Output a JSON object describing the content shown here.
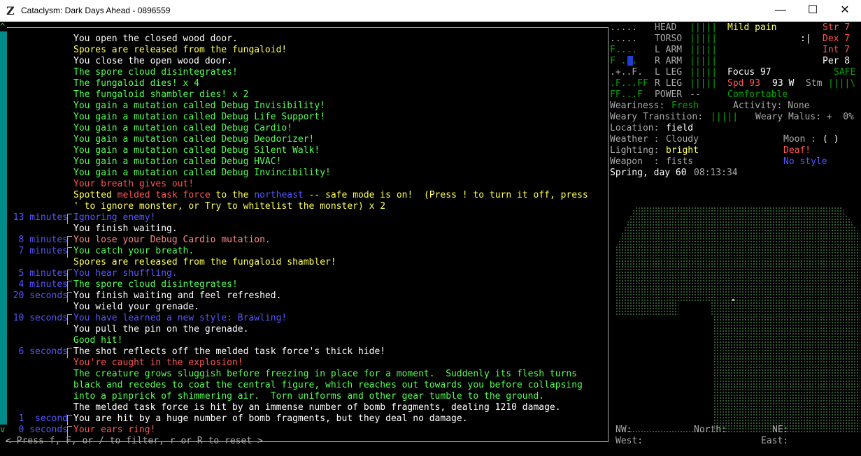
{
  "window": {
    "title": "Cataclysm: Dark Days Ahead - 0896559",
    "icon": "Z",
    "minimize_glyph": "—",
    "maximize_glyph": "☐",
    "close_glyph": "✕"
  },
  "colors": {
    "white": "#ffffff",
    "yellow": "#ffff55",
    "green": "#55ff55",
    "red": "#ff5555",
    "blue": "#5555ff",
    "lightred": "#ff8888",
    "gray": "#aaaaaa",
    "darkgreen": "#00aa00"
  },
  "scroll": {
    "up": "^",
    "down": "v"
  },
  "log": [
    {
      "time": "",
      "parts": [
        {
          "text": "You open the closed wood door.",
          "color": "white"
        }
      ]
    },
    {
      "time": "",
      "parts": [
        {
          "text": "Spores are released from the fungaloid!",
          "color": "yellow"
        }
      ]
    },
    {
      "time": "",
      "parts": [
        {
          "text": "You close the open wood door.",
          "color": "white"
        }
      ]
    },
    {
      "time": "",
      "parts": [
        {
          "text": "The spore cloud disintegrates!",
          "color": "green"
        }
      ]
    },
    {
      "time": "",
      "parts": [
        {
          "text": "The fungaloid dies! x 4",
          "color": "green"
        }
      ]
    },
    {
      "time": "",
      "parts": [
        {
          "text": "The fungaloid shambler dies! x 2",
          "color": "green"
        }
      ]
    },
    {
      "time": "",
      "parts": [
        {
          "text": "You gain a mutation called Debug Invisibility!",
          "color": "green"
        }
      ]
    },
    {
      "time": "",
      "parts": [
        {
          "text": "You gain a mutation called Debug Life Support!",
          "color": "green"
        }
      ]
    },
    {
      "time": "",
      "parts": [
        {
          "text": "You gain a mutation called Debug Cardio!",
          "color": "green"
        }
      ]
    },
    {
      "time": "",
      "parts": [
        {
          "text": "You gain a mutation called Debug Deodorizer!",
          "color": "green"
        }
      ]
    },
    {
      "time": "",
      "parts": [
        {
          "text": "You gain a mutation called Debug Silent Walk!",
          "color": "green"
        }
      ]
    },
    {
      "time": "",
      "parts": [
        {
          "text": "You gain a mutation called Debug HVAC!",
          "color": "green"
        }
      ]
    },
    {
      "time": "",
      "parts": [
        {
          "text": "You gain a mutation called Debug Invincibility!",
          "color": "green"
        }
      ]
    },
    {
      "time": "",
      "parts": [
        {
          "text": "Your breath gives out!",
          "color": "red"
        }
      ]
    },
    {
      "time": "",
      "parts": [
        {
          "text": "Spotted ",
          "color": "yellow"
        },
        {
          "text": "melded task force",
          "color": "red"
        },
        {
          "text": " to the ",
          "color": "yellow"
        },
        {
          "text": "northeast",
          "color": "blue"
        },
        {
          "text": " -- safe mode is on!  (Press ! to turn it off, press",
          "color": "yellow"
        }
      ]
    },
    {
      "time": "",
      "parts": [
        {
          "text": "' to ignore monster, or Try to whitelist the monster) x 2",
          "color": "yellow"
        }
      ]
    },
    {
      "time": "13 minutes",
      "parts": [
        {
          "text": "Ignoring enemy!",
          "color": "blue"
        }
      ]
    },
    {
      "time": "",
      "parts": [
        {
          "text": "You finish waiting.",
          "color": "white"
        }
      ]
    },
    {
      "time": "8 minutes",
      "parts": [
        {
          "text": "You lose your Debug Cardio mutation.",
          "color": "lightred"
        }
      ]
    },
    {
      "time": "7 minutes",
      "parts": [
        {
          "text": "You catch your breath.",
          "color": "green"
        }
      ]
    },
    {
      "time": "",
      "parts": [
        {
          "text": "Spores are released from the fungaloid shambler!",
          "color": "yellow"
        }
      ]
    },
    {
      "time": "5 minutes",
      "parts": [
        {
          "text": "You hear shuffling.",
          "color": "blue"
        }
      ]
    },
    {
      "time": "4 minutes",
      "parts": [
        {
          "text": "The spore cloud disintegrates!",
          "color": "green"
        }
      ]
    },
    {
      "time": "20 seconds",
      "parts": [
        {
          "text": "You finish waiting and feel refreshed.",
          "color": "white"
        }
      ]
    },
    {
      "time": "",
      "parts": [
        {
          "text": "You wield your grenade.",
          "color": "white"
        }
      ]
    },
    {
      "time": "10 seconds",
      "parts": [
        {
          "text": "You have learned a new style: Brawling!",
          "color": "blue"
        }
      ]
    },
    {
      "time": "",
      "parts": [
        {
          "text": "You pull the pin on the grenade.",
          "color": "white"
        }
      ]
    },
    {
      "time": "",
      "parts": [
        {
          "text": "Good hit!",
          "color": "green"
        }
      ]
    },
    {
      "time": "6 seconds",
      "parts": [
        {
          "text": "The shot reflects off the melded task force's thick hide!",
          "color": "white"
        }
      ]
    },
    {
      "time": "",
      "parts": [
        {
          "text": "You're caught in the explosion!",
          "color": "red"
        }
      ]
    },
    {
      "time": "",
      "parts": [
        {
          "text": "The creature grows sluggish before freezing in place for a moment.  Suddenly its flesh turns",
          "color": "green"
        }
      ]
    },
    {
      "time": "",
      "parts": [
        {
          "text": "black and recedes to coat the central figure, which reaches out towards you before collapsing",
          "color": "green"
        }
      ]
    },
    {
      "time": "",
      "parts": [
        {
          "text": "into a pinprick of shimmering air.  Torn uniforms and other gear tumble to the ground.",
          "color": "green"
        }
      ]
    },
    {
      "time": "",
      "parts": [
        {
          "text": "The melded task force is hit by an immense number of bomb fragments, dealing 1210 damage.",
          "color": "white"
        }
      ]
    },
    {
      "time": "1  second",
      "parts": [
        {
          "text": "You are hit by a huge number of bomb fragments, but they deal no damage.",
          "color": "white"
        }
      ]
    },
    {
      "time": "0 seconds",
      "parts": [
        {
          "text": "Your ears ring!",
          "color": "red"
        }
      ]
    }
  ],
  "filter_hint": "< Press f, F, or / to filter, r or R to reset >",
  "body": [
    {
      "glyph": ".....",
      "glyph_color": "gray",
      "part": "HEAD",
      "bars": "|||||"
    },
    {
      "glyph": ".....",
      "glyph_color": "gray",
      "part": "TORSO",
      "bars": "|||||"
    },
    {
      "glyph": "F....",
      "glyph_color": "darkgreen",
      "part": "L ARM",
      "bars": "|||||"
    },
    {
      "glyph": "F ...",
      "glyph_color": "darkgreen",
      "part": "R ARM",
      "bars": "|||||"
    },
    {
      "glyph": ".+..F.",
      "glyph_color": "gray",
      "part": "L LEG",
      "bars": "|||||"
    },
    {
      "glyph": ".F...FF",
      "glyph_color": "darkgreen",
      "part": "R LEG",
      "bars": "|||||"
    },
    {
      "glyph": "FF...F",
      "glyph_color": "darkgreen",
      "part": "POWER",
      "bars": "--"
    }
  ],
  "status": {
    "pain": "Mild pain",
    "str": "Str 7",
    "dex": "Dex 7",
    "int": "Int 7",
    "per": "Per 8",
    "face": ":|",
    "focus": "Focus 97",
    "safe": "SAFE",
    "spd": "Spd 93",
    "weight": "93 W",
    "stm_label": "Stm",
    "stm_bars": "||||\\",
    "temp": "Comfortable",
    "weariness_label": "Weariness:",
    "weariness_value": "Fresh",
    "activity": "Activity: None",
    "weary_transition_label": "Weary Transition:",
    "weary_transition_bars": "|||||",
    "weary_malus": "Weary Malus: +  0%",
    "location_label": "Location:",
    "location_value": "field",
    "weather_label": "Weather :",
    "weather_value": "Cloudy",
    "moon_label": "Moon :",
    "moon_value": "( )",
    "lighting_label": "Lighting:",
    "lighting_value": "bright",
    "deaf": "Deaf!",
    "weapon_label": "Weapon  :",
    "weapon_value": "fists",
    "style": "No style",
    "date": "Spring, day 60",
    "time": "08:13:34"
  },
  "compass": {
    "nw": "NW:",
    "north": "North:",
    "ne": "NE:",
    "west": "West:",
    "east": "East:"
  }
}
